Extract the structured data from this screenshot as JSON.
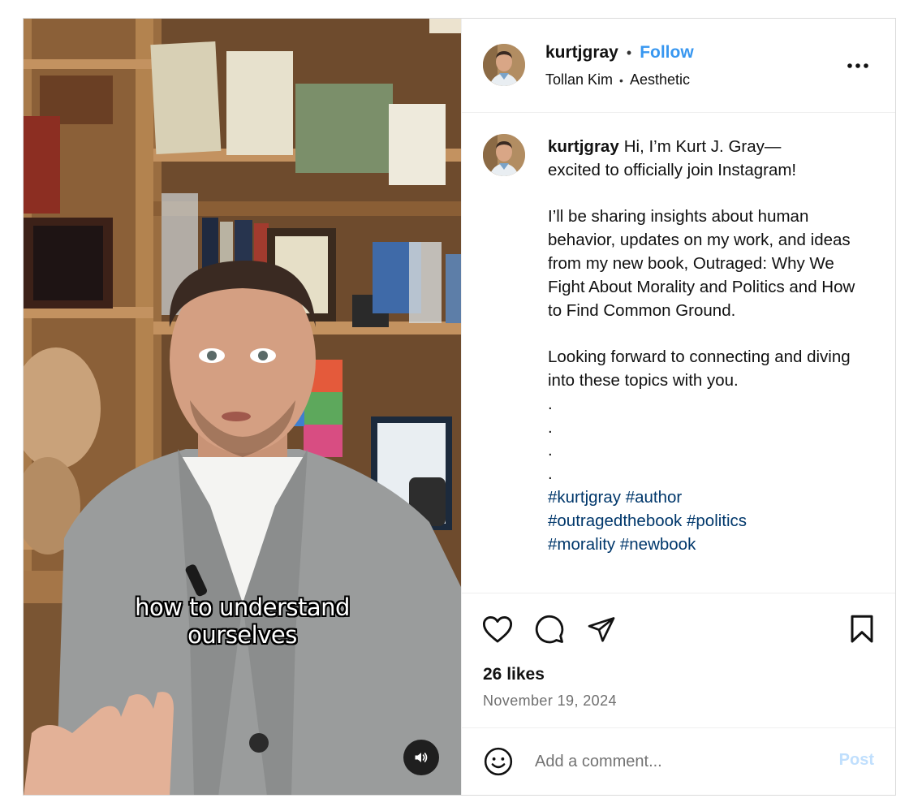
{
  "media": {
    "overlay_caption_line1": "how to understand",
    "overlay_caption_line2": "ourselves",
    "audio_icon": "speaker-icon"
  },
  "header": {
    "username": "kurtjgray",
    "follow_label": "Follow",
    "audio_artist": "Tollan Kim",
    "audio_title": "Aesthetic",
    "more_icon": "more-horizontal-icon"
  },
  "caption": {
    "username": "kurtjgray",
    "text": "Hi, I’m Kurt J. Gray—\nexcited to officially join Instagram!\n\nI’ll be sharing insights about human behavior, updates on my work, and ideas from my new book, Outraged: Why We Fight About Morality and Politics and How to Find Common Ground.\n\nLooking forward to connecting and diving into these topics with you.\n.\n.\n.\n.",
    "hashtags": [
      "#kurtjgray",
      "#author",
      "#outragedthebook",
      "#politics",
      "#morality",
      "#newbook"
    ]
  },
  "actions": {
    "likes": "26 likes",
    "date": "November 19, 2024"
  },
  "comment_box": {
    "placeholder": "Add a comment...",
    "post_label": "Post"
  },
  "colors": {
    "follow_blue": "#3897f0",
    "hashtag_blue": "#00376b",
    "post_disabled": "#c0dffd"
  }
}
